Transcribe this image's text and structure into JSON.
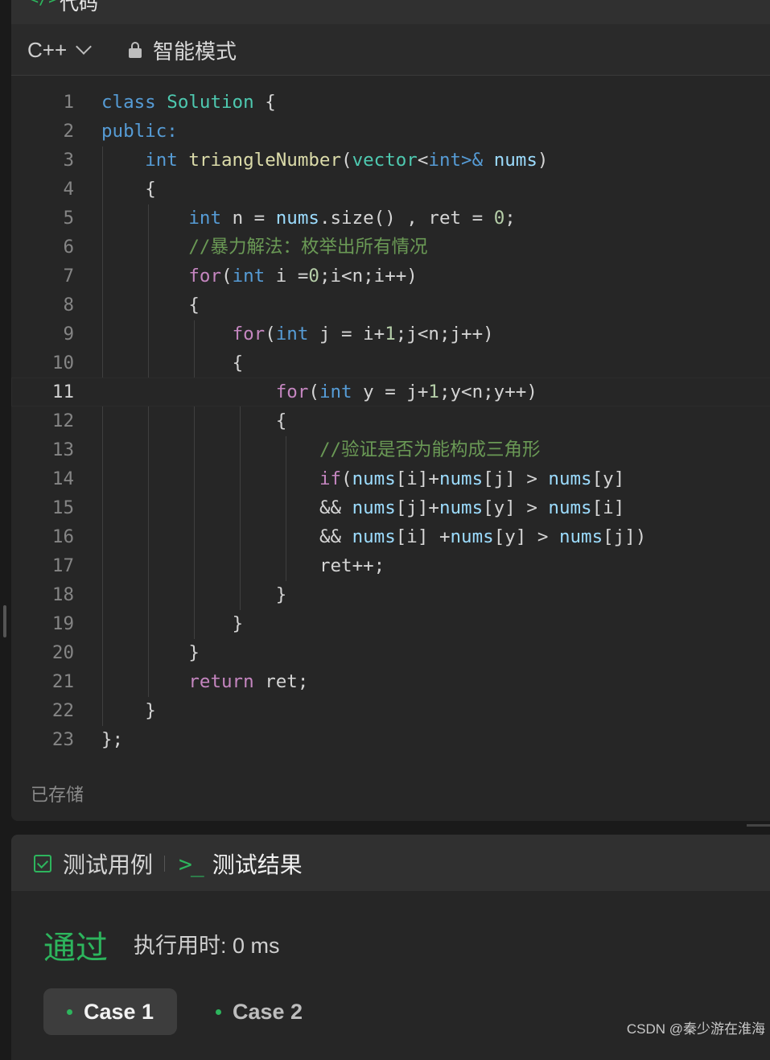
{
  "header": {
    "title": "代码",
    "icon": "code-brackets-icon"
  },
  "toolbar": {
    "language": "C++",
    "mode_label": "智能模式"
  },
  "editor": {
    "active_line": 11,
    "lines": [
      {
        "n": "1"
      },
      {
        "n": "2"
      },
      {
        "n": "3"
      },
      {
        "n": "4"
      },
      {
        "n": "5"
      },
      {
        "n": "6"
      },
      {
        "n": "7"
      },
      {
        "n": "8"
      },
      {
        "n": "9"
      },
      {
        "n": "10"
      },
      {
        "n": "11"
      },
      {
        "n": "12"
      },
      {
        "n": "13"
      },
      {
        "n": "14"
      },
      {
        "n": "15"
      },
      {
        "n": "16"
      },
      {
        "n": "17"
      },
      {
        "n": "18"
      },
      {
        "n": "19"
      },
      {
        "n": "20"
      },
      {
        "n": "21"
      },
      {
        "n": "22"
      },
      {
        "n": "23"
      }
    ],
    "code": {
      "l1": [
        "class",
        "Solution",
        "{"
      ],
      "l2": [
        "public",
        ":"
      ],
      "l3": [
        "int",
        "triangleNumber",
        "(",
        "vector",
        "<",
        "int",
        ">&",
        "nums",
        ")"
      ],
      "l4": [
        "{"
      ],
      "l5": [
        "int",
        "n =",
        "nums",
        ".size() , ret =",
        "0",
        ";"
      ],
      "l6": [
        "//暴力解法：枚举出所有情况"
      ],
      "l7": [
        "for",
        "(",
        "int",
        "i =",
        "0",
        ";i<n;i++)"
      ],
      "l8": [
        "{"
      ],
      "l9": [
        "for",
        "(",
        "int",
        "j = i+",
        "1",
        ";j<n;j++)"
      ],
      "l10": [
        "{"
      ],
      "l11": [
        "for",
        "(",
        "int",
        "y = j+",
        "1",
        ";y<n;y++)"
      ],
      "l12": [
        "{"
      ],
      "l13": [
        "//验证是否为能构成三角形"
      ],
      "l14": [
        "if",
        "(",
        "nums",
        "[i]+",
        "nums",
        "[j] > ",
        "nums",
        "[y]"
      ],
      "l15": [
        "&& ",
        "nums",
        "[j]+",
        "nums",
        "[y] > ",
        "nums",
        "[i]"
      ],
      "l16": [
        "&& ",
        "nums",
        "[i] +",
        "nums",
        "[y] > ",
        "nums",
        "[j])"
      ],
      "l17": [
        "ret++;"
      ],
      "l18": [
        "}"
      ],
      "l19": [
        "}"
      ],
      "l20": [
        "}"
      ],
      "l21": [
        "return",
        "ret;"
      ],
      "l22": [
        "}"
      ],
      "l23": [
        "};"
      ]
    },
    "saved_status": "已存储"
  },
  "tests": {
    "tab_testcase": "测试用例",
    "tab_result": "测试结果",
    "status": "通过",
    "exec_time": "执行用时: 0 ms",
    "cases": [
      "Case 1",
      "Case 2"
    ]
  },
  "watermark": "CSDN @秦少游在淮海",
  "colors": {
    "accent_green": "#2db55d",
    "background": "#1a1a1a",
    "panel": "#262626"
  }
}
